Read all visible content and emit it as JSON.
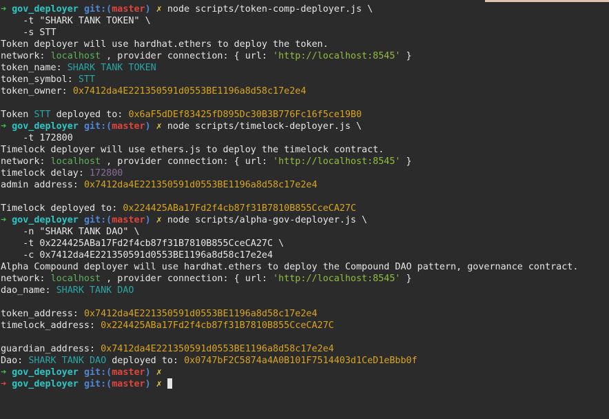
{
  "prompt": {
    "arrow": "➜",
    "dir": "gov_deployer",
    "git_prefix": "git:(",
    "branch": "master",
    "git_suffix": ")",
    "dirty": "✗"
  },
  "cmd1": {
    "command": "node scripts/token-comp-deployer.js \\",
    "arg1": "    -t \"SHARK TANK TOKEN\" \\",
    "arg2": "    -s STT"
  },
  "out1": {
    "intro": "Token deployer will use hardhat.ethers to deploy the token.",
    "network_label": "network: ",
    "network": "localhost",
    "provider_label": " , provider connection: { url: ",
    "url": "'http://localhost:8545'",
    "close": " }",
    "token_name_label": "token_name: ",
    "token_name": "SHARK TANK TOKEN",
    "token_symbol_label": "token_symbol: ",
    "token_symbol": "STT",
    "token_owner_label": "token_owner: ",
    "token_owner": "0x7412da4E221350591d0553BE1196a8d58c17e2e4",
    "deployed_prefix": "Token ",
    "deployed_symbol": "STT",
    "deployed_label": " deployed to: ",
    "deployed_address": "0x6aF5dDEf83425fD895Dc30B3B776Fc16f5ce19B0"
  },
  "cmd2": {
    "command": "node scripts/timelock-deployer.js \\",
    "arg1": "    -t 172800"
  },
  "out2": {
    "intro": "Timelock deployer will use ethers.js to deploy the timelock contract.",
    "delay_label": "timelock delay: ",
    "delay": "172800",
    "admin_label": "admin address: ",
    "admin": "0x7412da4E221350591d0553BE1196a8d58c17e2e4",
    "deployed_label": "Timelock deployed to: ",
    "deployed_address": "0x224425ABa17Fd2f4cb87f31B7810B855CceCA27C"
  },
  "cmd3": {
    "command": "node scripts/alpha-gov-deployer.js \\",
    "arg1": "    -n \"SHARK TANK DAO\" \\",
    "arg2": "    -t 0x224425ABa17Fd2f4cb87f31B7810B855CceCA27C \\",
    "arg3": "    -c 0x7412da4E221350591d0553BE1196a8d58c17e2e4"
  },
  "out3": {
    "intro": "Alpha Compound deployer will use hardhat.ethers to deploy the Compound DAO pattern, governance contract.",
    "dao_name_label": "dao_name: ",
    "dao_name": "SHARK TANK DAO",
    "token_address_label": "token_address: ",
    "token_address": "0x7412da4E221350591d0553BE1196a8d58c17e2e4",
    "timelock_address_label": "timelock_address: ",
    "timelock_address": "0x224425ABa17Fd2f4cb87f31B7810B855CceCA27C",
    "guardian_address_label": "guardian_address: ",
    "guardian_address": "0x7412da4E221350591d0553BE1196a8d58c17e2e4",
    "dao_prefix": "Dao: ",
    "dao_deployed_name": "SHARK TANK DAO",
    "deployed_label": " deployed to: ",
    "deployed_address": "0x0747bF2C5874a4A0B101F7514403d1CeD1eBbb0f"
  },
  "colors": {
    "background": "#2b2b2b",
    "arrow_ok": "#3fc24a",
    "arrow_err": "#e0453c",
    "dir": "#2ec5c5",
    "git": "#4f86d6",
    "branch": "#e0453c",
    "address": "#d9a520",
    "value_cyan": "#2aa6a6",
    "network": "#5fb25a",
    "url": "#8fbf3f",
    "number": "#8d6b9c"
  }
}
